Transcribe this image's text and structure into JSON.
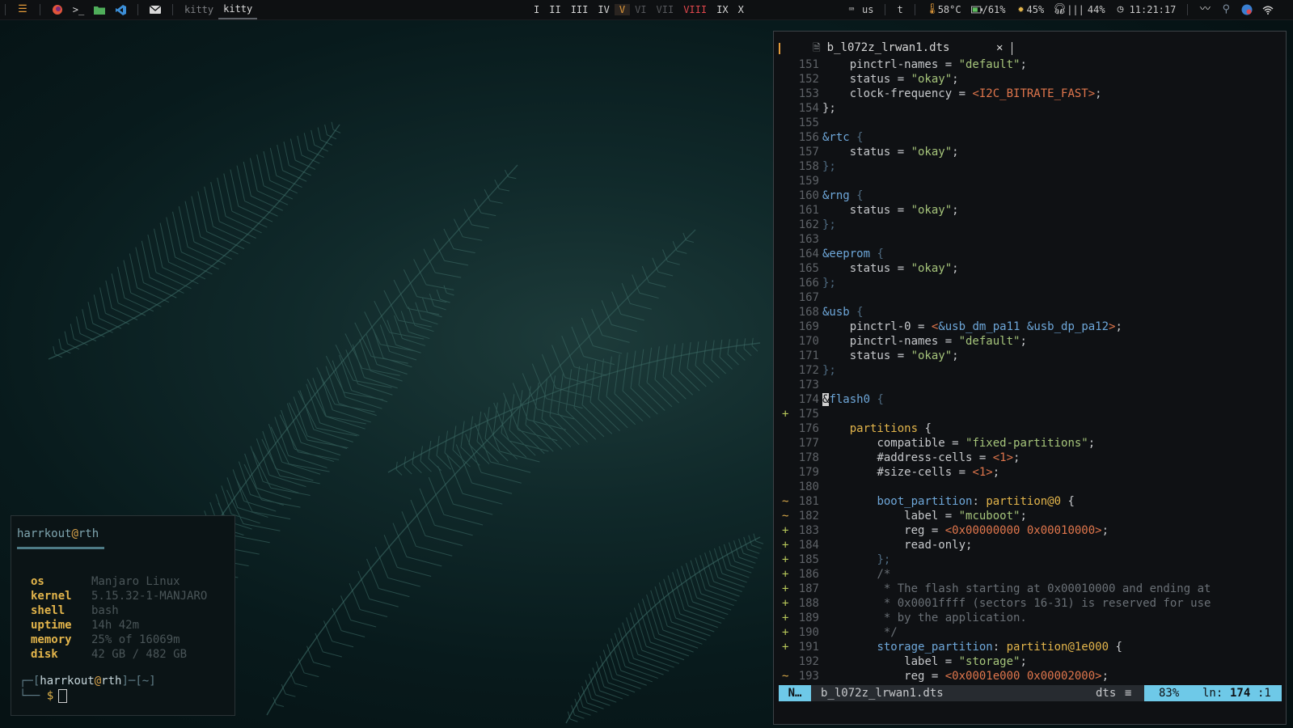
{
  "topbar": {
    "icons": [
      "menu-icon",
      "firefox-icon",
      "terminal-icon",
      "folder-icon",
      "vscode-icon",
      "mail-icon"
    ],
    "windows": [
      {
        "label": "kitty",
        "active": false
      },
      {
        "label": "kitty",
        "active": true
      }
    ],
    "workspaces": [
      {
        "label": "I",
        "state": "normal"
      },
      {
        "label": "II",
        "state": "normal"
      },
      {
        "label": "III",
        "state": "normal"
      },
      {
        "label": "IV",
        "state": "normal"
      },
      {
        "label": "V",
        "state": "active"
      },
      {
        "label": "VI",
        "state": "dim"
      },
      {
        "label": "VII",
        "state": "dim"
      },
      {
        "label": "VIII",
        "state": "urgent"
      },
      {
        "label": "IX",
        "state": "normal"
      },
      {
        "label": "X",
        "state": "normal"
      }
    ],
    "keyboard_layout": "us",
    "t_label": "t",
    "temperature": "58°C",
    "battery": "/61%",
    "brightness": "45%",
    "volume": "44%",
    "clock": "11:21:17"
  },
  "fetch": {
    "title_user": "harrkout",
    "title_at": "@",
    "title_host": "rth",
    "rows": [
      {
        "key": "os",
        "value": "Manjaro Linux"
      },
      {
        "key": "kernel",
        "value": "5.15.32-1-MANJARO"
      },
      {
        "key": "shell",
        "value": "bash"
      },
      {
        "key": "uptime",
        "value": "14h 42m"
      },
      {
        "key": "memory",
        "value": "25% of 16069m"
      },
      {
        "key": "disk",
        "value": "42 GB / 482 GB"
      }
    ],
    "prompt_open": "┌─[",
    "prompt_user": "harrkout",
    "prompt_at": "@",
    "prompt_host": "rth",
    "prompt_mid": "]─[",
    "prompt_dir": "~",
    "prompt_close": "]",
    "prompt_line2": "└──",
    "prompt_dollar": "$"
  },
  "editor": {
    "tab_filename": "b_l072z_lrwan1.dts",
    "tab_close": "✕",
    "lines": [
      {
        "n": "151",
        "s": "",
        "t": [
          [
            "",
            "    "
          ],
          [
            "c-key",
            "pinctrl-names = "
          ],
          [
            "c-str",
            "\"default\""
          ],
          [
            "c-key",
            ";"
          ]
        ]
      },
      {
        "n": "152",
        "s": "",
        "t": [
          [
            "",
            "    "
          ],
          [
            "c-key",
            "status = "
          ],
          [
            "c-str",
            "\"okay\""
          ],
          [
            "c-key",
            ";"
          ]
        ]
      },
      {
        "n": "153",
        "s": "",
        "t": [
          [
            "",
            "    "
          ],
          [
            "c-key",
            "clock-frequency = "
          ],
          [
            "c-macro",
            "<I2C_BITRATE_FAST>"
          ],
          [
            "c-key",
            ";"
          ]
        ]
      },
      {
        "n": "154",
        "s": "",
        "t": [
          [
            "c-key",
            "};"
          ]
        ]
      },
      {
        "n": "155",
        "s": "",
        "t": []
      },
      {
        "n": "156",
        "s": "",
        "t": [
          [
            "c-ref",
            "&rtc"
          ],
          [
            "c-punc",
            " {"
          ]
        ]
      },
      {
        "n": "157",
        "s": "",
        "t": [
          [
            "",
            "    "
          ],
          [
            "c-key",
            "status = "
          ],
          [
            "c-str",
            "\"okay\""
          ],
          [
            "c-key",
            ";"
          ]
        ]
      },
      {
        "n": "158",
        "s": "",
        "t": [
          [
            "c-punc",
            "};"
          ]
        ]
      },
      {
        "n": "159",
        "s": "",
        "t": []
      },
      {
        "n": "160",
        "s": "",
        "t": [
          [
            "c-ref",
            "&rng"
          ],
          [
            "c-punc",
            " {"
          ]
        ]
      },
      {
        "n": "161",
        "s": "",
        "t": [
          [
            "",
            "    "
          ],
          [
            "c-key",
            "status = "
          ],
          [
            "c-str",
            "\"okay\""
          ],
          [
            "c-key",
            ";"
          ]
        ]
      },
      {
        "n": "162",
        "s": "",
        "t": [
          [
            "c-punc",
            "};"
          ]
        ]
      },
      {
        "n": "163",
        "s": "",
        "t": []
      },
      {
        "n": "164",
        "s": "",
        "t": [
          [
            "c-ref",
            "&eeprom"
          ],
          [
            "c-punc",
            " {"
          ]
        ]
      },
      {
        "n": "165",
        "s": "",
        "t": [
          [
            "",
            "    "
          ],
          [
            "c-key",
            "status = "
          ],
          [
            "c-str",
            "\"okay\""
          ],
          [
            "c-key",
            ";"
          ]
        ]
      },
      {
        "n": "166",
        "s": "",
        "t": [
          [
            "c-punc",
            "};"
          ]
        ]
      },
      {
        "n": "167",
        "s": "",
        "t": []
      },
      {
        "n": "168",
        "s": "",
        "t": [
          [
            "c-ref",
            "&usb"
          ],
          [
            "c-punc",
            " {"
          ]
        ]
      },
      {
        "n": "169",
        "s": "",
        "t": [
          [
            "",
            "    "
          ],
          [
            "c-key",
            "pinctrl-0 = "
          ],
          [
            "c-macro",
            "<"
          ],
          [
            "c-ref",
            "&usb_dm_pa11 &usb_dp_pa12"
          ],
          [
            "c-macro",
            ">"
          ],
          [
            "c-key",
            ";"
          ]
        ]
      },
      {
        "n": "170",
        "s": "",
        "t": [
          [
            "",
            "    "
          ],
          [
            "c-key",
            "pinctrl-names = "
          ],
          [
            "c-str",
            "\"default\""
          ],
          [
            "c-key",
            ";"
          ]
        ]
      },
      {
        "n": "171",
        "s": "",
        "t": [
          [
            "",
            "    "
          ],
          [
            "c-key",
            "status = "
          ],
          [
            "c-str",
            "\"okay\""
          ],
          [
            "c-key",
            ";"
          ]
        ]
      },
      {
        "n": "172",
        "s": "",
        "t": [
          [
            "c-punc",
            "};"
          ]
        ]
      },
      {
        "n": "173",
        "s": "",
        "t": []
      },
      {
        "n": "174",
        "s": "",
        "t": [
          [
            "c-cursor",
            "&"
          ],
          [
            "c-ref",
            "flash0"
          ],
          [
            "c-punc",
            " {"
          ]
        ]
      },
      {
        "n": "175",
        "s": "+",
        "t": []
      },
      {
        "n": "176",
        "s": "",
        "t": [
          [
            "",
            "    "
          ],
          [
            "c-node",
            "partitions"
          ],
          [
            "c-key",
            " {"
          ]
        ]
      },
      {
        "n": "177",
        "s": "",
        "t": [
          [
            "",
            "        "
          ],
          [
            "c-key",
            "compatible = "
          ],
          [
            "c-str",
            "\"fixed-partitions\""
          ],
          [
            "c-key",
            ";"
          ]
        ]
      },
      {
        "n": "178",
        "s": "",
        "t": [
          [
            "",
            "        "
          ],
          [
            "c-key",
            "#address-cells = "
          ],
          [
            "c-macro",
            "<1>"
          ],
          [
            "c-key",
            ";"
          ]
        ]
      },
      {
        "n": "179",
        "s": "",
        "t": [
          [
            "",
            "        "
          ],
          [
            "c-key",
            "#size-cells = "
          ],
          [
            "c-macro",
            "<1>"
          ],
          [
            "c-key",
            ";"
          ]
        ]
      },
      {
        "n": "180",
        "s": "",
        "t": []
      },
      {
        "n": "181",
        "s": "~",
        "t": [
          [
            "",
            "        "
          ],
          [
            "c-label",
            "boot_partition"
          ],
          [
            "c-key",
            ": "
          ],
          [
            "c-node",
            "partition@0"
          ],
          [
            "c-key",
            " {"
          ]
        ]
      },
      {
        "n": "182",
        "s": "~",
        "t": [
          [
            "",
            "            "
          ],
          [
            "c-key",
            "label = "
          ],
          [
            "c-str",
            "\"mcuboot\""
          ],
          [
            "c-key",
            ";"
          ]
        ]
      },
      {
        "n": "183",
        "s": "+",
        "t": [
          [
            "",
            "            "
          ],
          [
            "c-key",
            "reg = "
          ],
          [
            "c-macro",
            "<0x00000000 0x00010000>"
          ],
          [
            "c-key",
            ";"
          ]
        ]
      },
      {
        "n": "184",
        "s": "+",
        "t": [
          [
            "",
            "            "
          ],
          [
            "c-key",
            "read-only;"
          ]
        ]
      },
      {
        "n": "185",
        "s": "+",
        "t": [
          [
            "",
            "        "
          ],
          [
            "c-punc",
            "};"
          ]
        ]
      },
      {
        "n": "186",
        "s": "+",
        "t": [
          [
            "",
            "        "
          ],
          [
            "c-comment",
            "/*"
          ]
        ]
      },
      {
        "n": "187",
        "s": "+",
        "t": [
          [
            "",
            "         "
          ],
          [
            "c-comment",
            "* The flash starting at 0x00010000 and ending at"
          ]
        ]
      },
      {
        "n": "188",
        "s": "+",
        "t": [
          [
            "",
            "         "
          ],
          [
            "c-comment",
            "* 0x0001ffff (sectors 16-31) is reserved for use"
          ]
        ]
      },
      {
        "n": "189",
        "s": "+",
        "t": [
          [
            "",
            "         "
          ],
          [
            "c-comment",
            "* by the application."
          ]
        ]
      },
      {
        "n": "190",
        "s": "+",
        "t": [
          [
            "",
            "         "
          ],
          [
            "c-comment",
            "*/"
          ]
        ]
      },
      {
        "n": "191",
        "s": "+",
        "t": [
          [
            "",
            "        "
          ],
          [
            "c-label",
            "storage_partition"
          ],
          [
            "c-key",
            ": "
          ],
          [
            "c-node",
            "partition@1e000"
          ],
          [
            "c-key",
            " {"
          ]
        ]
      },
      {
        "n": "192",
        "s": "",
        "t": [
          [
            "",
            "            "
          ],
          [
            "c-key",
            "label = "
          ],
          [
            "c-str",
            "\"storage\""
          ],
          [
            "c-key",
            ";"
          ]
        ]
      },
      {
        "n": "193",
        "s": "~",
        "t": [
          [
            "",
            "            "
          ],
          [
            "c-key",
            "reg = "
          ],
          [
            "c-macro",
            "<0x0001e000 0x00002000>"
          ],
          [
            "c-key",
            ";"
          ]
        ]
      }
    ],
    "status": {
      "mode": "N…",
      "filename": "b_l072z_lrwan1.dts",
      "filetype": "dts",
      "filetype_icon": "≡",
      "percent": "83%",
      "pos_label": "ln:",
      "line": "174",
      "col": ":1"
    }
  }
}
